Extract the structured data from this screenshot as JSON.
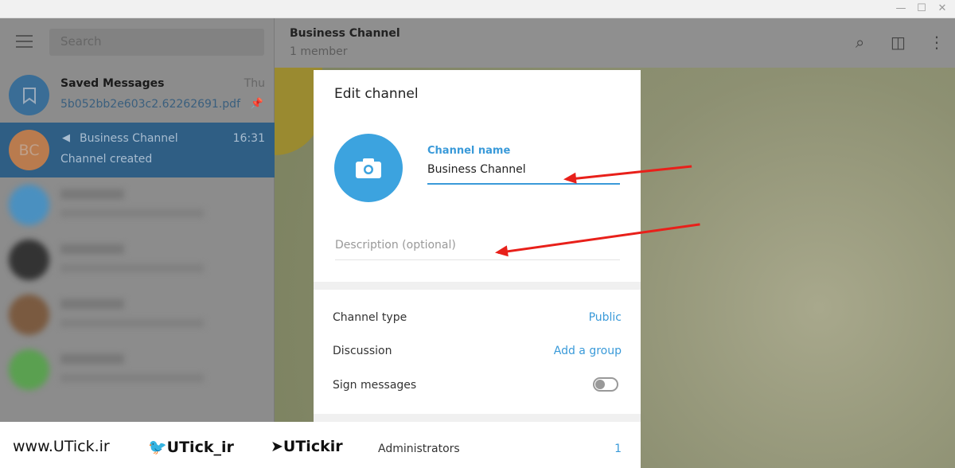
{
  "window": {
    "minimize": "—",
    "maximize": "☐",
    "close": "✕"
  },
  "sidebar": {
    "search_placeholder": "Search",
    "chats": [
      {
        "name": "Saved Messages",
        "message": "5b052bb2e603c2.62262691.pdf",
        "time": "Thu",
        "pinned": true
      },
      {
        "name": "Business Channel",
        "initials": "BC",
        "message": "Channel created",
        "time": "16:31",
        "selected": true
      }
    ]
  },
  "header": {
    "title": "Business Channel",
    "subtitle": "1 member"
  },
  "dialog": {
    "title": "Edit channel",
    "name_label": "Channel name",
    "name_value": "Business Channel",
    "description_placeholder": "Description (optional)",
    "rows": [
      {
        "label": "Channel type",
        "value": "Public"
      },
      {
        "label": "Discussion",
        "value": "Add a group"
      },
      {
        "label": "Sign messages",
        "toggle": false
      },
      {
        "label": "Administrators",
        "value": "1"
      }
    ]
  },
  "watermark": {
    "site": "www.UTick.ir",
    "twitter": "UTick_ir",
    "telegram": "UTickir"
  },
  "colors": {
    "accent": "#3a9ad9",
    "arrow": "#e8201a"
  }
}
